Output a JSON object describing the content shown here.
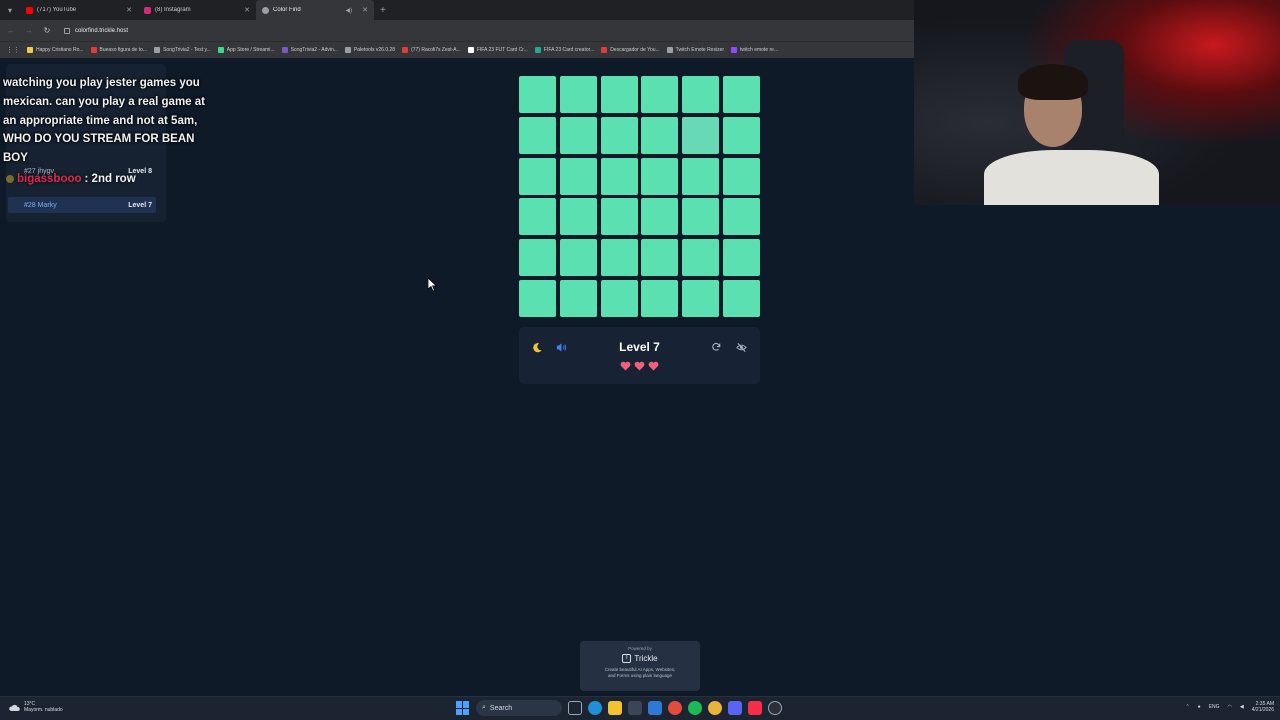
{
  "browser": {
    "tabs": [
      {
        "label": "(717) YouTube",
        "color": "#ff0000",
        "active": false
      },
      {
        "label": "(8) Instagram",
        "color": "#d62976",
        "active": false
      },
      {
        "label": "Color Find",
        "color": "#9aa0a6",
        "active": true
      }
    ],
    "url": "colorfind.trickle.host",
    "bookmarks": [
      {
        "label": "Happy Cristiano Ro...",
        "color": "#f2c94c"
      },
      {
        "label": "Bueaso figura de to...",
        "color": "#e53935"
      },
      {
        "label": "SongTrivia2 - Test y...",
        "color": "#9aa0a6"
      },
      {
        "label": "App Store / Streami...",
        "color": "#3ddc84"
      },
      {
        "label": "SongTrivia2 - Advin...",
        "color": "#7e57c2"
      },
      {
        "label": "Paletools v26.0.28",
        "color": "#9aa0a6"
      },
      {
        "label": "(77) Racoli7s Zest-A...",
        "color": "#e53935"
      },
      {
        "label": "FIFA 23 FUT Card Cr...",
        "color": "#ffffff"
      },
      {
        "label": "FIFA 23 Card creator...",
        "color": "#26a69a"
      },
      {
        "label": "Descargador de You...",
        "color": "#e53935"
      },
      {
        "label": "Twitch Emote Resizer",
        "color": "#9aa0a6"
      },
      {
        "label": "twitch emote re...",
        "color": "#9146ff"
      }
    ]
  },
  "chat": {
    "message1": "watching you play jester games you mexican. can you play a real game at an appropriate time and not at 5am, WHO DO YOU STREAM FOR BEAN BOY",
    "message2_user": "bigassbooo",
    "message2_text": ": 2nd row"
  },
  "leaderboard": {
    "rows": [
      {
        "rank": "#27",
        "name": "jhygv",
        "level": "Level 8"
      },
      {
        "rank": "#28",
        "name": "Marky",
        "level": "Level 7"
      }
    ]
  },
  "game": {
    "grid_size": 6,
    "base_color": "#5be0b2",
    "odd_color": "#67d9b4",
    "odd_cell": {
      "row": 1,
      "col": 4
    },
    "level_label": "Level 7",
    "lives": 3,
    "heart_color": "#f0607a",
    "moon_color": "#f2c230",
    "sound_color": "#4a7cf0"
  },
  "trickle": {
    "powered": "Powered by",
    "name": "Trickle",
    "caption_line1": "Create beautiful AI Apps, Websites,",
    "caption_line2": "and Forms using plain language"
  },
  "taskbar": {
    "temp": "13°C",
    "weather": "Mayorm. nublado",
    "search": "Search",
    "lang": "ENG",
    "time": "2:35 AM",
    "date": "4/21/2026"
  }
}
